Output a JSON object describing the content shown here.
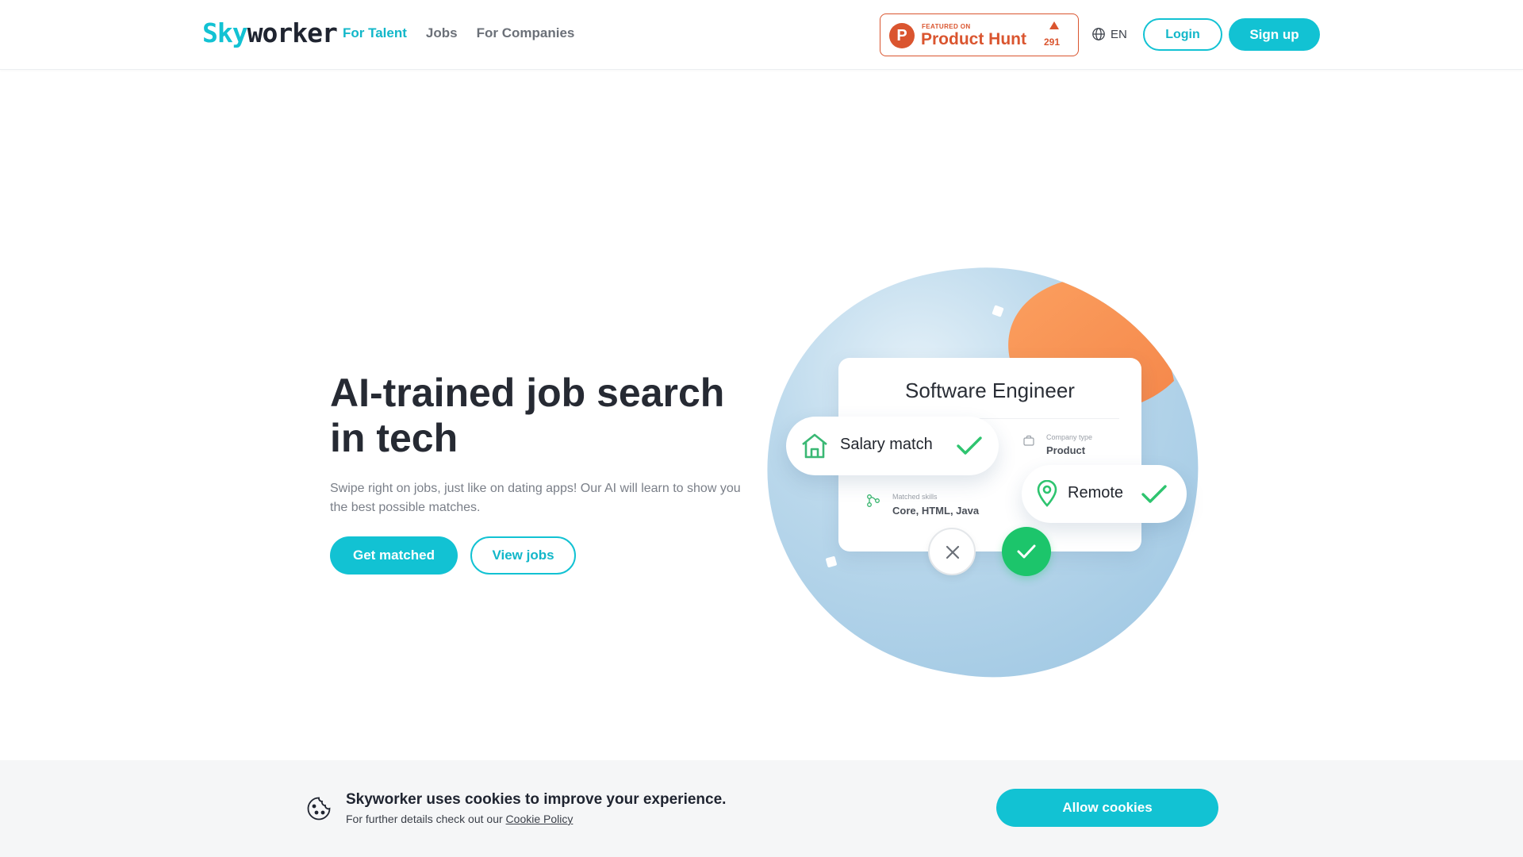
{
  "header": {
    "logo": {
      "part1": "Sky",
      "part2": "worker"
    },
    "nav": [
      {
        "label": "For Talent",
        "active": true
      },
      {
        "label": "Jobs",
        "active": false
      },
      {
        "label": "For Companies",
        "active": false
      }
    ],
    "product_hunt": {
      "featured": "FEATURED ON",
      "name": "Product Hunt",
      "count": "291",
      "letter": "P"
    },
    "language": "EN",
    "login_label": "Login",
    "signup_label": "Sign up"
  },
  "hero": {
    "title_line1": "AI-trained job search",
    "title_line2": "in tech",
    "subtitle": "Swipe right on jobs, just like on dating apps! Our AI will learn to show you the best possible matches.",
    "get_matched_label": "Get matched",
    "view_jobs_label": "View jobs"
  },
  "illustration": {
    "card_title": "Software Engineer",
    "company_type_label": "Company type",
    "company_type_value": "Product",
    "matched_skills_label": "Matched skills",
    "matched_skills_value": "Core, HTML, Java",
    "salary_pill": "Salary match",
    "remote_pill": "Remote"
  },
  "cookie": {
    "title": "Skyworker uses cookies to improve your experience.",
    "text": "For further details check out our",
    "link": "Cookie Policy",
    "allow_label": "Allow cookies"
  },
  "colors": {
    "accent": "#12c2d3",
    "product_hunt": "#da552f",
    "success": "#1cc56b",
    "blob": "#a9cde6",
    "orange": "#f7955a"
  }
}
